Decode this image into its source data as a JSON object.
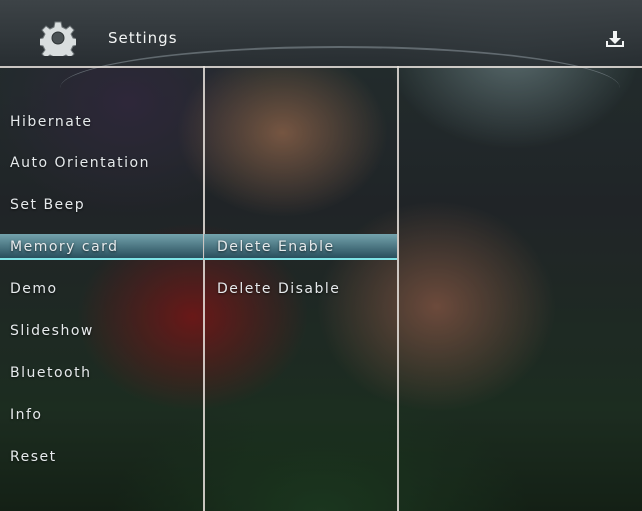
{
  "header": {
    "title": "Settings",
    "gear_icon": "gear-icon",
    "action_icon": "download-icon"
  },
  "menu": {
    "items": [
      {
        "label": "Hibernate"
      },
      {
        "label": "Auto Orientation"
      },
      {
        "label": "Set Beep"
      },
      {
        "label": "Memory card",
        "selected": true
      },
      {
        "label": "Demo"
      },
      {
        "label": "Slideshow"
      },
      {
        "label": "Bluetooth"
      },
      {
        "label": "Info"
      },
      {
        "label": "Reset"
      }
    ]
  },
  "submenu": {
    "items": [
      {
        "label": "Delete Enable",
        "selected": true
      },
      {
        "label": "Delete Disable"
      }
    ]
  },
  "colors": {
    "highlight_top": "#78aab4",
    "highlight_bottom": "#28505f",
    "highlight_line": "#7fe3e6",
    "divider": "#e6e1dc",
    "text": "#e6eaec"
  }
}
